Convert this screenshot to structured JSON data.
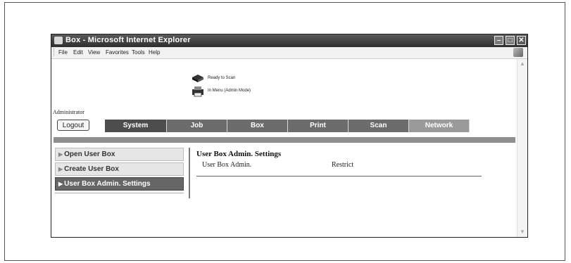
{
  "window": {
    "title": "Box - Microsoft Internet Explorer",
    "controls": {
      "minimize": "–",
      "maximize": "□",
      "close": "✕"
    }
  },
  "menubar": {
    "items": [
      "File",
      "Edit",
      "View",
      "Favorites",
      "Tools",
      "Help"
    ]
  },
  "status": {
    "line1": "Ready to Scan",
    "line2": "In Menu (Admin Mode)"
  },
  "user": {
    "name": "Administrator",
    "logout_label": "Logout"
  },
  "tabs": [
    "System",
    "Job",
    "Box",
    "Print",
    "Scan",
    "Network"
  ],
  "sidebar": {
    "items": [
      {
        "label": "Open User Box"
      },
      {
        "label": "Create User Box"
      },
      {
        "label": "User Box Admin. Settings"
      }
    ],
    "active_index": 2
  },
  "panel": {
    "title": "User Box Admin. Settings",
    "row_label": "User Box Admin.",
    "row_value": "Restrict"
  },
  "colors": {
    "tab_bg": "#6c6c6c",
    "tab_faded_bg": "#9a9a9a",
    "sidebar_active_bg": "#666666",
    "titlebar_bg": "#3a3a3a"
  }
}
